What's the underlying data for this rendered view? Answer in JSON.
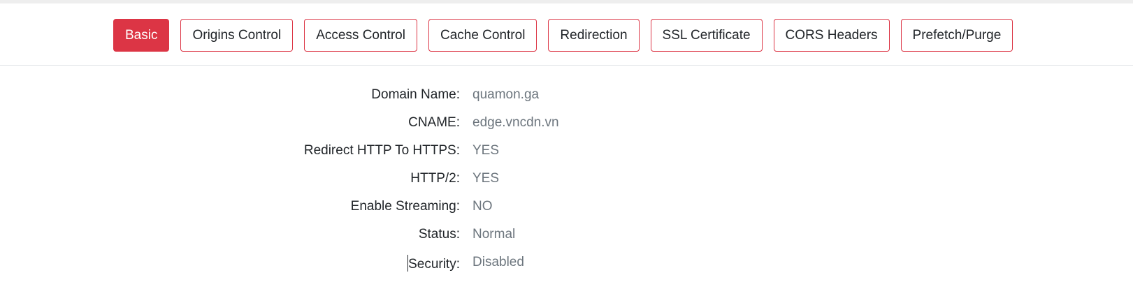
{
  "tabs": [
    {
      "label": "Basic",
      "active": true
    },
    {
      "label": "Origins Control",
      "active": false
    },
    {
      "label": "Access Control",
      "active": false
    },
    {
      "label": "Cache Control",
      "active": false
    },
    {
      "label": "Redirection",
      "active": false
    },
    {
      "label": "SSL Certificate",
      "active": false
    },
    {
      "label": "CORS Headers",
      "active": false
    },
    {
      "label": "Prefetch/Purge",
      "active": false
    }
  ],
  "info": {
    "domain_name": {
      "label": "Domain Name:",
      "value": "quamon.ga"
    },
    "cname": {
      "label": "CNAME:",
      "value": "edge.vncdn.vn"
    },
    "redirect_https": {
      "label": "Redirect HTTP To HTTPS:",
      "value": "YES"
    },
    "http2": {
      "label": "HTTP/2:",
      "value": "YES"
    },
    "streaming": {
      "label": "Enable Streaming:",
      "value": "NO"
    },
    "status": {
      "label": "Status:",
      "value": "Normal"
    },
    "security": {
      "label": "Security:",
      "value": "Disabled"
    }
  },
  "colors": {
    "accent": "#dc3545",
    "label_text": "#212529",
    "value_text": "#6c757d"
  }
}
